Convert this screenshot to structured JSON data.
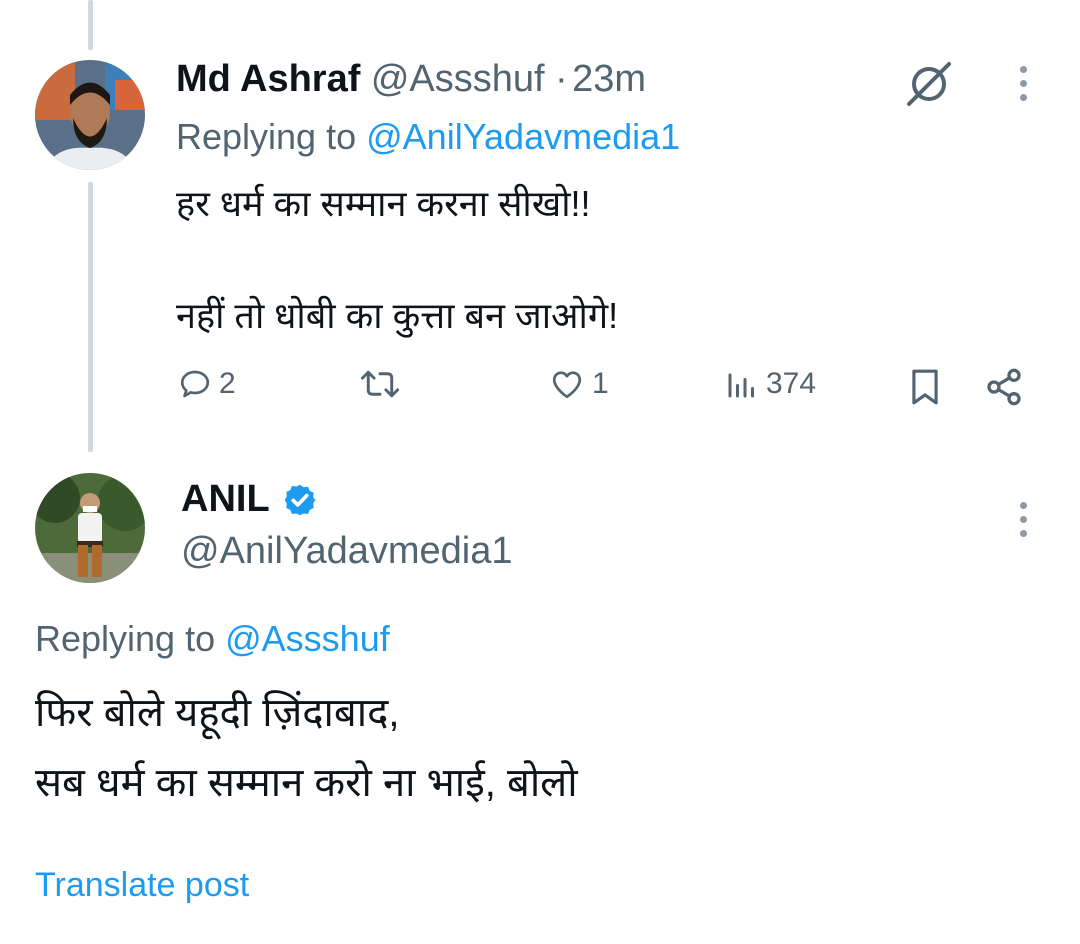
{
  "tweet1": {
    "name": "Md Ashraf",
    "handle": "@Assshuf",
    "separator": "·",
    "time": "23m",
    "replying_prefix": "Replying to",
    "replying_handle": "@AnilYadavmedia1",
    "text": "हर धर्म का सम्मान करना सीखो!!\n\nनहीं तो धोबी का कुत्ता बन जाओगे!",
    "replies": "2",
    "likes": "1",
    "views": "374",
    "icons": [
      "grok-icon",
      "more-icon",
      "reply-icon",
      "retweet-icon",
      "like-icon",
      "views-icon",
      "bookmark-icon",
      "share-icon"
    ]
  },
  "tweet2": {
    "name": "ANIL",
    "handle": "@AnilYadavmedia1",
    "replying_prefix": "Replying to",
    "replying_handle": "@Assshuf",
    "text": "फिर बोले यहूदी ज़िंदाबाद,\nसब धर्म का सम्मान करो ना भाई, बोलो",
    "translate": "Translate post",
    "icons": [
      "verified-badge-icon",
      "more-icon"
    ]
  },
  "colors": {
    "accent": "#1d9bf0",
    "secondary_text": "#536471",
    "thread_line": "#cfd9de"
  }
}
